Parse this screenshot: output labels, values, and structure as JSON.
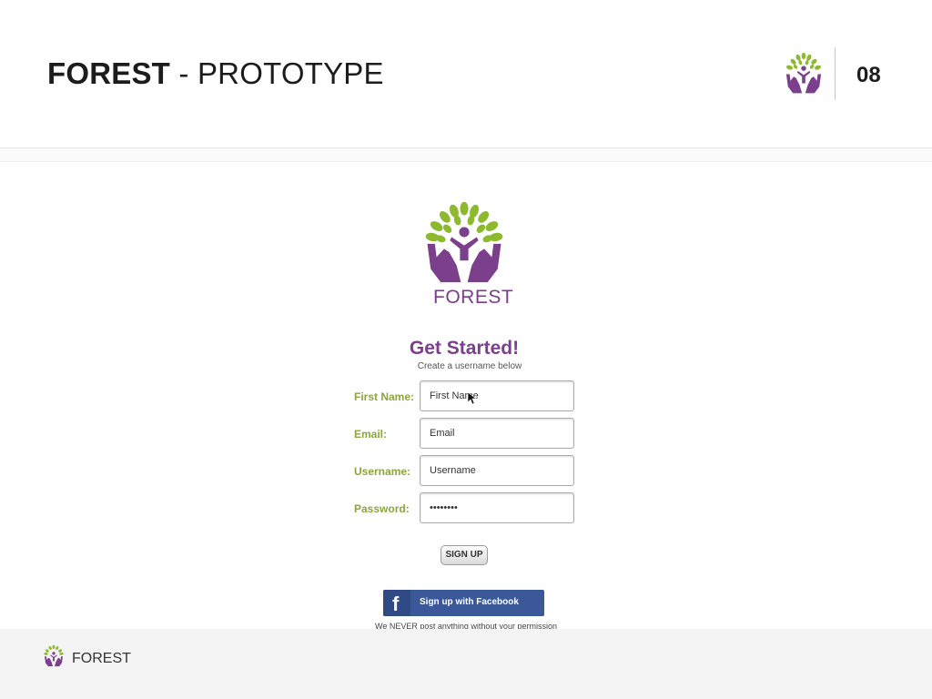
{
  "header": {
    "title_bold": "FOREST",
    "title_rest": " - PROTOTYPE",
    "page_number": "08"
  },
  "app": {
    "brand_name": "FOREST",
    "heading": "Get Started!",
    "subtitle": "Create a username below",
    "fields": [
      {
        "label": "First Name:",
        "value": "First Name",
        "placeholder": "First Name"
      },
      {
        "label": "Email:",
        "value": "",
        "placeholder": "Email"
      },
      {
        "label": "Username:",
        "value": "",
        "placeholder": "Username"
      },
      {
        "label": "Password:",
        "value": "••••••••",
        "placeholder": ""
      }
    ],
    "signup_button": "SIGN UP",
    "facebook_icon": "f",
    "facebook_button": "Sign up with Facebook",
    "permission_note": "We NEVER post anything without your permission"
  },
  "footer": {
    "brand": "FOREST"
  },
  "colors": {
    "brand_purple": "#7b3f8c",
    "leaf_green": "#8db92e",
    "label_green": "#8aa63c",
    "facebook_blue": "#3b5998"
  },
  "icons": [
    "forest-logo-icon",
    "mouse-cursor-icon",
    "facebook-icon"
  ]
}
